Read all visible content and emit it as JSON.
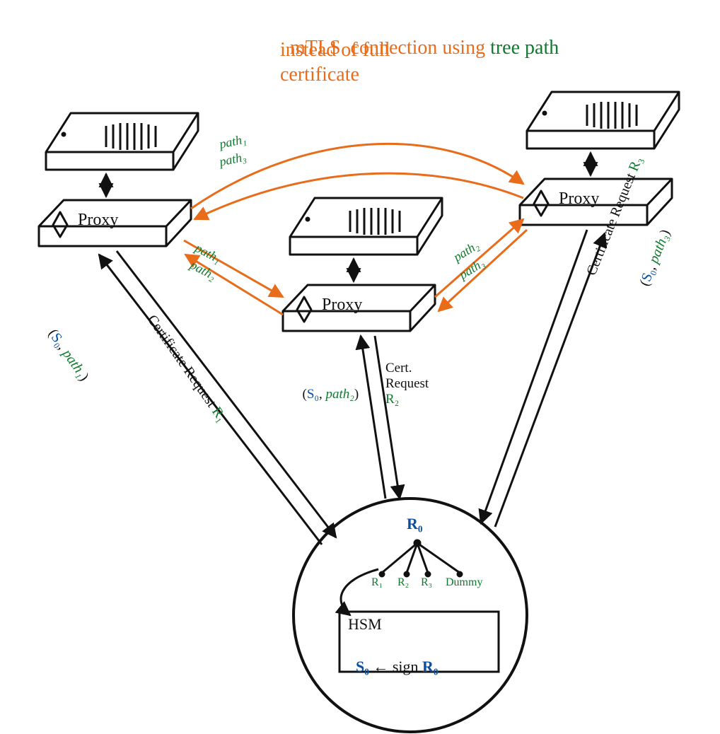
{
  "title": {
    "line1_orange": "mTLS  connection using ",
    "line1_green": "tree path",
    "line2": "instead of full",
    "line3": "certificate"
  },
  "proxies": {
    "left": "Proxy",
    "middle": "Proxy",
    "right": "Proxy"
  },
  "paths_labels": {
    "pl_top_top": "path₁",
    "pl_top_bottom": "path₃",
    "pl_lm_top": "path₁",
    "pl_lm_bottom": "path₂",
    "pl_mr_top": "path₂",
    "pl_mr_bottom": "path₃"
  },
  "cert_requests": {
    "cr1_pre": "Certificate Request ",
    "cr1_r": "R₁",
    "cr2_pre": "Cert. Request",
    "cr2_r": "R₂",
    "cr3_pre": "Certificate Request ",
    "cr3_r": "R₃"
  },
  "responses": {
    "resp1_open": "(",
    "resp1_s0": "S₀",
    "resp1_comma": ", ",
    "resp1_path": "path₁",
    "resp1_close": ")",
    "resp2_open": "(",
    "resp2_s0": "S₀",
    "resp2_comma": ", ",
    "resp2_path": "path₂",
    "resp2_close": ")",
    "resp3_open": "(",
    "resp3_s0": "S₀",
    "resp3_comma": ", ",
    "resp3_path": "path₃",
    "resp3_close": ")"
  },
  "ca": {
    "r0": "R₀",
    "r1": "R₁",
    "r2": "R₂",
    "r3": "R₃",
    "dummy": "Dummy",
    "hsm": "HSM",
    "s0": "S₀",
    "arrow_text": " ← sign ",
    "r0b": "R₀"
  }
}
